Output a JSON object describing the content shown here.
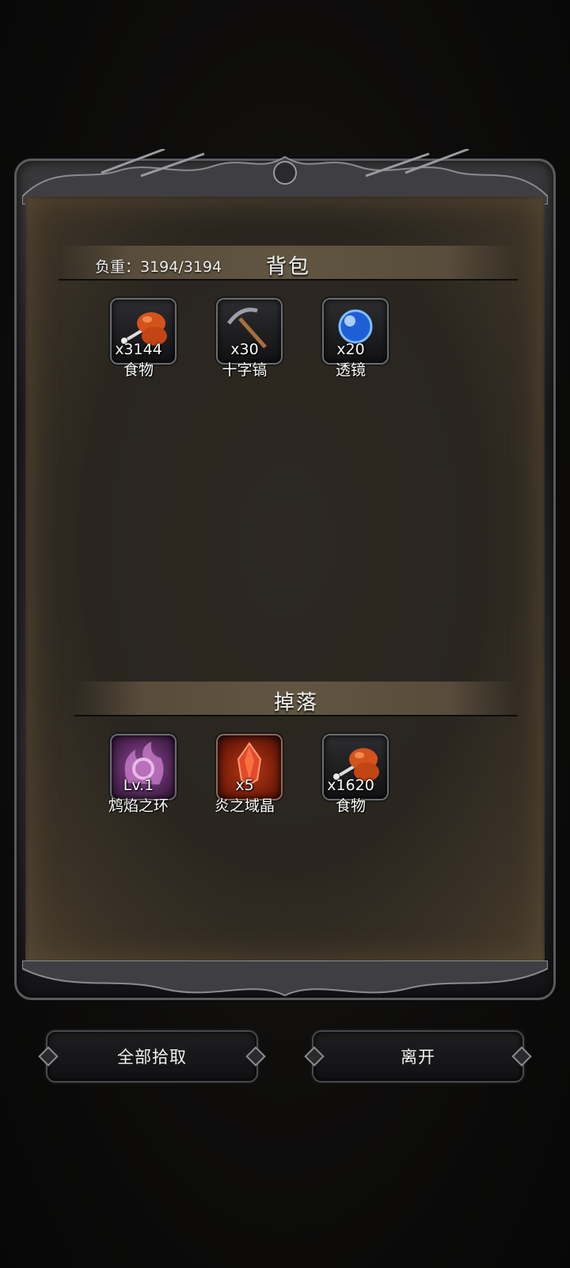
{
  "backpack": {
    "weight_label": "负重：3194/3194",
    "title": "背包",
    "items": [
      {
        "name": "食物",
        "qty": "x3144",
        "icon": "food-icon"
      },
      {
        "name": "十字镐",
        "qty": "x30",
        "icon": "pickaxe-icon"
      },
      {
        "name": "透镜",
        "qty": "x20",
        "icon": "lens-icon"
      }
    ]
  },
  "drops": {
    "title": "掉落",
    "items": [
      {
        "name": "鸩焰之环",
        "qty": "Lv.1",
        "icon": "flame-ring-icon"
      },
      {
        "name": "炎之域晶",
        "qty": "x5",
        "icon": "fire-crystal-icon"
      },
      {
        "name": "食物",
        "qty": "x1620",
        "icon": "food-icon"
      }
    ]
  },
  "buttons": {
    "pickup_all": "全部拾取",
    "leave": "离开"
  },
  "colors": {
    "parchment": "#2d2922",
    "frame": "#2b2b2e",
    "fire_slot": "#b33a16"
  }
}
